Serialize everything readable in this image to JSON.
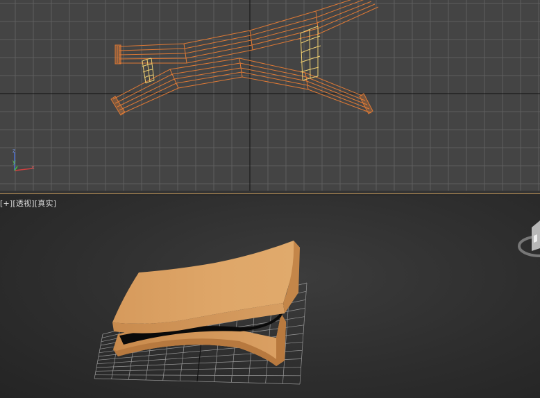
{
  "viewport_top": {
    "axis_labels": {
      "z": "z",
      "y": "y",
      "x": "x"
    },
    "colors": {
      "background": "#444444",
      "grid": "#5e5e5e",
      "axis": "#111111",
      "wire": "#e07a35",
      "selected_wire": "#f0d070"
    }
  },
  "viewport_perspective": {
    "label_menu": "[+]",
    "label_view": "[透视]",
    "label_shading": "[真实]",
    "colors": {
      "object": "#d9a066",
      "object_shadow": "#a8723f",
      "grid": "#9a9a9a"
    }
  }
}
